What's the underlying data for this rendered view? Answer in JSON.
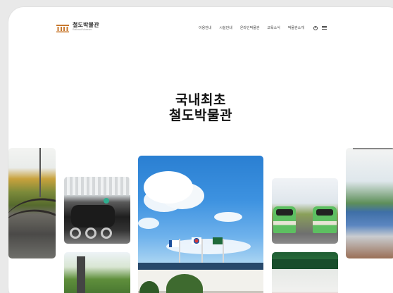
{
  "header": {
    "logo_title": "철도박물관",
    "logo_subtitle": "Railroad Museum",
    "nav": [
      "이용안내",
      "시설안내",
      "온라인박물관",
      "교육소식",
      "박물관소개"
    ]
  },
  "hero": {
    "line1": "국내최초",
    "line2": "철도박물관"
  },
  "colors": {
    "logo_accent": "#c8792f",
    "title": "#111111",
    "nav_text": "#444444"
  }
}
